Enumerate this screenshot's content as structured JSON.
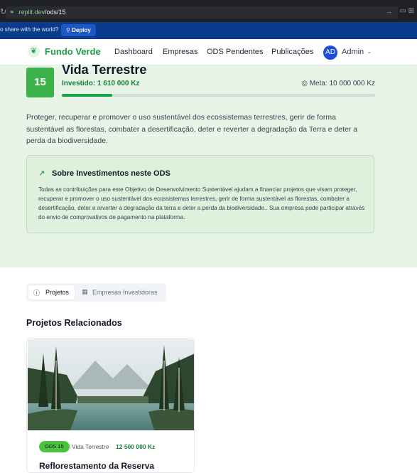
{
  "browser": {
    "url_domain": ".replit.dev",
    "url_path": "/ods/15"
  },
  "replit": {
    "share_text": "o share with the world?",
    "deploy_label": "Deploy"
  },
  "nav": {
    "brand": "Fundo Verde",
    "links": [
      "Dashboard",
      "Empresas",
      "ODS Pendentes",
      "Publicações"
    ],
    "avatar_initials": "AD",
    "user": "Admin"
  },
  "ods": {
    "number": "15",
    "title": "Vida Terrestre",
    "invested_label": "Investido: 1 610 000 Kz",
    "meta_label": "Meta: 10 000 000 Kz",
    "progress_fraction": 0.161,
    "description": "Proteger, recuperar e promover o uso sustentável dos ecossistemas terrestres, gerir de forma sustentável as florestas, combater a desertificação, deter e reverter a degradação da Terra e deter a perda da biodiversidade.",
    "info_title": "Sobre Investimentos neste ODS",
    "info_text": "Todas as contribuições para este Objetivo de Desenvolvimento Sustentável ajudam a financiar projetos que visam proteger, recuperar e promover o uso sustentável dos ecossistemas terrestres, gerir de forma sustentável as florestas, combater a desertificação, deter e reverter a degradação da terra e deter a perda da biodiversidade.. Sua empresa pode participar através do envio de comprovativos de pagamento na plataforma."
  },
  "tabs": {
    "projects": "Projetos",
    "companies": "Empresas Investidoras"
  },
  "projects_section": {
    "title": "Projetos Relacionados",
    "card": {
      "chip": "ODS 15",
      "ods_name": "Vida Terrestre",
      "amount": "12 500 000 Kz",
      "title": "Reflorestamento da Reserva"
    }
  },
  "colors": {
    "brand_green": "#1e9e46",
    "hero_bg": "#e8f5e6",
    "badge_green": "#3cb24a",
    "avatar_blue": "#1d4ed8"
  }
}
